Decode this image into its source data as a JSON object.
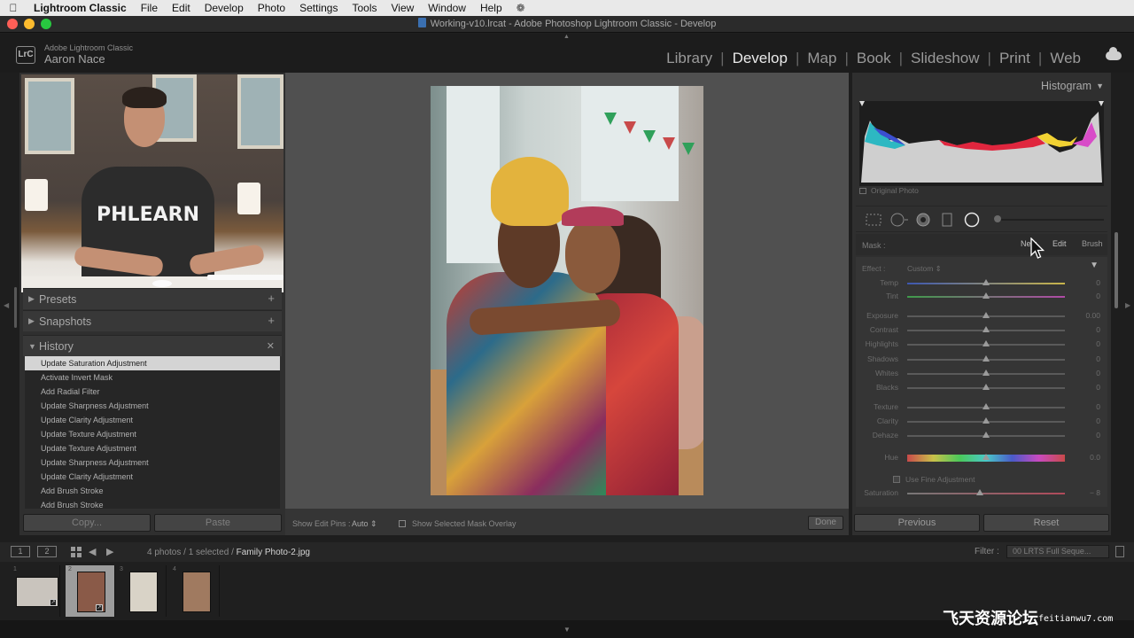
{
  "menubar": {
    "app_name": "Lightroom Classic",
    "items": [
      "File",
      "Edit",
      "Develop",
      "Photo",
      "Settings",
      "Tools",
      "View",
      "Window",
      "Help"
    ]
  },
  "window": {
    "title": "Working-v10.lrcat - Adobe Photoshop Lightroom Classic - Develop"
  },
  "identity": {
    "logo": "LrC",
    "product": "Adobe Lightroom Classic",
    "user": "Aaron Nace"
  },
  "modules": {
    "items": [
      "Library",
      "Develop",
      "Map",
      "Book",
      "Slideshow",
      "Print",
      "Web"
    ],
    "active": "Develop"
  },
  "left_panel": {
    "video_shirt_text": "PHLEARN",
    "presets_label": "Presets",
    "snapshots_label": "Snapshots",
    "history_label": "History",
    "history_items": [
      "Update Saturation Adjustment",
      "Activate Invert Mask",
      "Add Radial Filter",
      "Update Sharpness Adjustment",
      "Update Clarity Adjustment",
      "Update Texture Adjustment",
      "Update Texture Adjustment",
      "Update Sharpness Adjustment",
      "Update Clarity Adjustment",
      "Add Brush Stroke",
      "Add Brush Stroke"
    ],
    "copy_button": "Copy...",
    "paste_button": "Paste"
  },
  "toolbar": {
    "show_edit_pins_label": "Show Edit Pins :",
    "show_edit_pins_value": "Auto",
    "mask_overlay_label": "Show Selected Mask Overlay",
    "done_button": "Done"
  },
  "right_panel": {
    "histogram_label": "Histogram",
    "original_photo_label": "Original Photo",
    "mask_label": "Mask :",
    "mask_new": "New",
    "mask_edit": "Edit",
    "mask_brush": "Brush",
    "effect_label": "Effect :",
    "effect_value": "Custom",
    "sliders": [
      {
        "label": "Temp",
        "value": "0",
        "pos": 0.5
      },
      {
        "label": "Tint",
        "value": "0",
        "pos": 0.5
      },
      {
        "label": "Exposure",
        "value": "0.00",
        "pos": 0.5
      },
      {
        "label": "Contrast",
        "value": "0",
        "pos": 0.5
      },
      {
        "label": "Highlights",
        "value": "0",
        "pos": 0.5
      },
      {
        "label": "Shadows",
        "value": "0",
        "pos": 0.5
      },
      {
        "label": "Whites",
        "value": "0",
        "pos": 0.5
      },
      {
        "label": "Blacks",
        "value": "0",
        "pos": 0.5
      },
      {
        "label": "Texture",
        "value": "0",
        "pos": 0.5
      },
      {
        "label": "Clarity",
        "value": "0",
        "pos": 0.5
      },
      {
        "label": "Dehaze",
        "value": "0",
        "pos": 0.5
      },
      {
        "label": "Hue",
        "value": "0.0",
        "pos": 0.5
      },
      {
        "label": "Saturation",
        "value": "− 8",
        "pos": 0.46
      }
    ],
    "fine_adjustment_label": "Use Fine Adjustment",
    "previous_button": "Previous",
    "reset_button": "Reset"
  },
  "filmstrip_bar": {
    "monitor1": "1",
    "monitor2": "2",
    "info_prefix": "4 photos / 1 selected /",
    "filename": "Family Photo-2.jpg",
    "filter_label": "Filter :",
    "filter_value": "00 LRTS Full Seque..."
  },
  "filmstrip": {
    "thumbnails": [
      {
        "num": "1",
        "selected": false,
        "color": "#c9c4bd"
      },
      {
        "num": "2",
        "selected": true,
        "color": "#8a5a48"
      },
      {
        "num": "3",
        "selected": false,
        "color": "#d9d3c7"
      },
      {
        "num": "4",
        "selected": false,
        "color": "#a07a60"
      }
    ]
  },
  "watermark": {
    "main": "飞天资源论坛",
    "sub": "feitianwu7.com"
  },
  "colors": {
    "window_close": "#fe5f57",
    "window_min": "#febc2e",
    "window_max": "#28c840",
    "history_selected": "#d4d4d4"
  }
}
